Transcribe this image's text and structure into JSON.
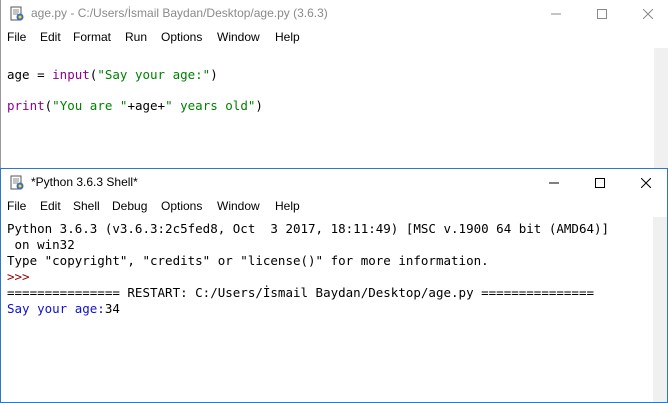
{
  "editor": {
    "title": "age.py - C:/Users/İsmail Baydan/Desktop/age.py (3.6.3)",
    "menu": [
      "File",
      "Edit",
      "Format",
      "Run",
      "Options",
      "Window",
      "Help"
    ],
    "code": {
      "line1": {
        "var": "age = ",
        "func": "input",
        "open": "(",
        "str": "\"Say your age:\"",
        "close": ")"
      },
      "line2": {
        "func": "print",
        "open": "(",
        "str1": "\"You are \"",
        "mid": "+age+",
        "str2": "\" years old\"",
        "close": ")"
      }
    }
  },
  "shell": {
    "title": "*Python 3.6.3 Shell*",
    "menu": [
      "File",
      "Edit",
      "Shell",
      "Debug",
      "Options",
      "Window",
      "Help"
    ],
    "lines": {
      "banner1": "Python 3.6.3 (v3.6.3:2c5fed8, Oct  3 2017, 18:11:49) [MSC v.1900 64 bit (AMD64)]",
      "banner2": " on win32",
      "banner3": "Type \"copyright\", \"credits\" or \"license()\" for more information.",
      "prompt": ">>>",
      "restart": "=============== RESTART: C:/Users/İsmail Baydan/Desktop/age.py ===============",
      "output_prompt": "Say your age:",
      "input_value": "34"
    }
  },
  "colors": {
    "keyword": "#900090",
    "string": "#008000",
    "output": "#1010d0",
    "prompt": "#900000"
  }
}
